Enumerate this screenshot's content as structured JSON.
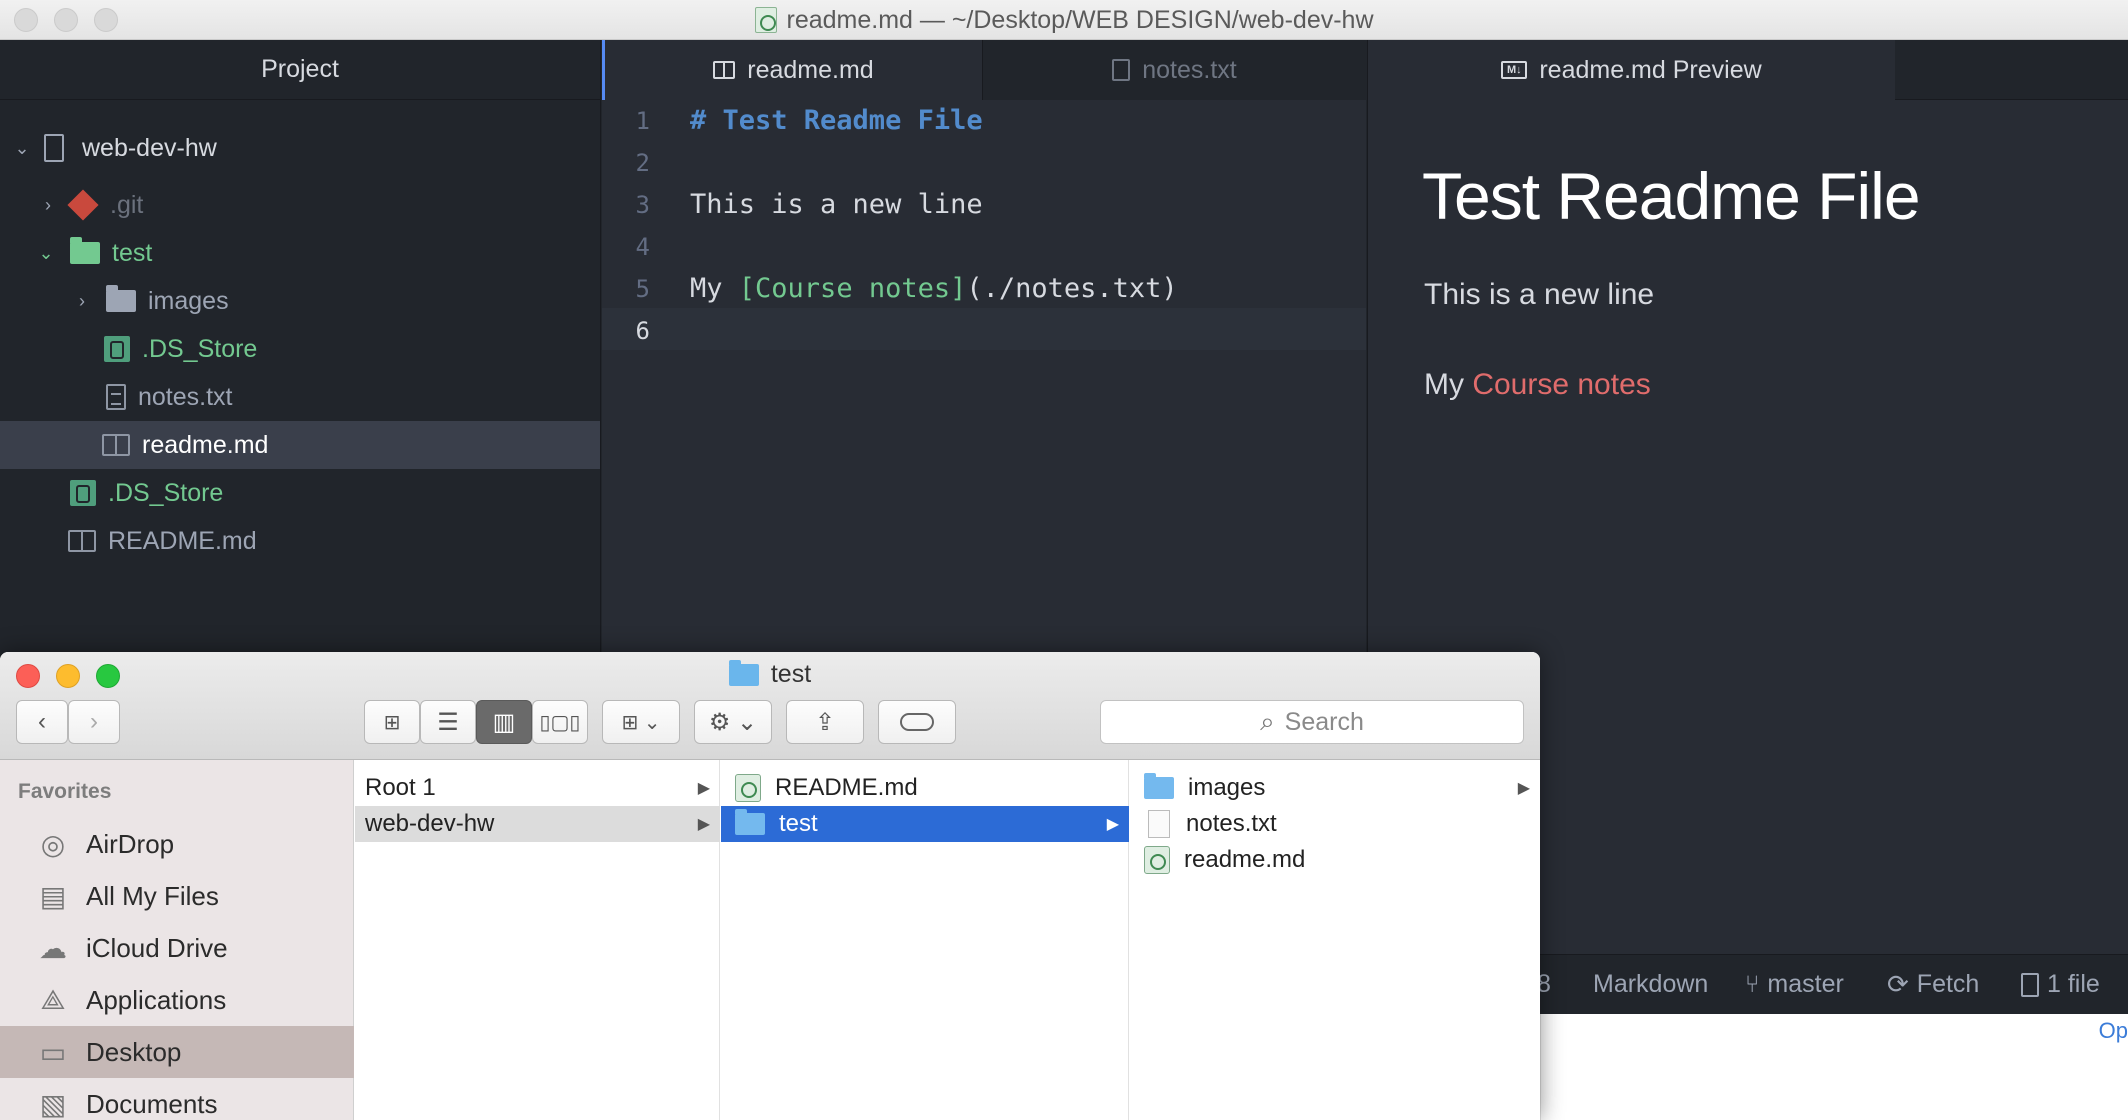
{
  "atom": {
    "window_title": "readme.md — ~/Desktop/WEB DESIGN/web-dev-hw",
    "tree": {
      "header": "Project",
      "items": [
        {
          "label": "web-dev-hw",
          "icon": "repo-icon"
        },
        {
          "label": ".git",
          "icon": "git-icon"
        },
        {
          "label": "test",
          "icon": "folder-icon"
        },
        {
          "label": "images",
          "icon": "folder-icon"
        },
        {
          "label": ".DS_Store",
          "icon": "finder-file-icon"
        },
        {
          "label": "notes.txt",
          "icon": "text-file-icon"
        },
        {
          "label": "readme.md",
          "icon": "book-icon"
        },
        {
          "label": ".DS_Store",
          "icon": "finder-file-icon"
        },
        {
          "label": "README.md",
          "icon": "book-icon"
        }
      ]
    },
    "editor": {
      "tabs": [
        {
          "label": "readme.md",
          "icon": "book-icon"
        },
        {
          "label": "notes.txt",
          "icon": "text-file-icon"
        }
      ],
      "line_numbers": [
        "1",
        "2",
        "3",
        "4",
        "5",
        "6"
      ],
      "lines": {
        "l1": "# Test Readme File",
        "l3": "This is a new line",
        "l5_prefix": "My ",
        "l5_link": "[Course notes]",
        "l5_target": "(./notes.txt)"
      }
    },
    "preview": {
      "tab_label": "readme.md Preview",
      "tab_icon_text": "M↓",
      "h1": "Test Readme File",
      "p1": "This is a new line",
      "p2_prefix": "My ",
      "p2_link": "Course notes"
    },
    "status_bar": {
      "partial": "8",
      "grammar": "Markdown",
      "branch": "master",
      "fetch": "Fetch",
      "files": "1 file"
    }
  },
  "behind_window_text": "Op",
  "finder": {
    "title": "test",
    "search_placeholder": "Search",
    "sidebar": {
      "section": "Favorites",
      "items": [
        {
          "label": "AirDrop",
          "icon": "airdrop-icon"
        },
        {
          "label": "All My Files",
          "icon": "all-files-icon"
        },
        {
          "label": "iCloud Drive",
          "icon": "cloud-icon"
        },
        {
          "label": "Applications",
          "icon": "applications-icon"
        },
        {
          "label": "Desktop",
          "icon": "desktop-icon"
        },
        {
          "label": "Documents",
          "icon": "documents-icon"
        }
      ]
    },
    "columns": [
      [
        {
          "label": "Root 1"
        },
        {
          "label": "web-dev-hw"
        }
      ],
      [
        {
          "label": "README.md"
        },
        {
          "label": "test"
        }
      ],
      [
        {
          "label": "images"
        },
        {
          "label": "notes.txt"
        },
        {
          "label": "readme.md"
        }
      ]
    ]
  },
  "colors": {
    "atom_bg": "#282c34",
    "tree_bg": "#21252b",
    "git_green": "#73c990",
    "link_red": "#e06c6c",
    "md_heading_blue": "#528bcc",
    "finder_select_blue": "#2c6bd6"
  }
}
